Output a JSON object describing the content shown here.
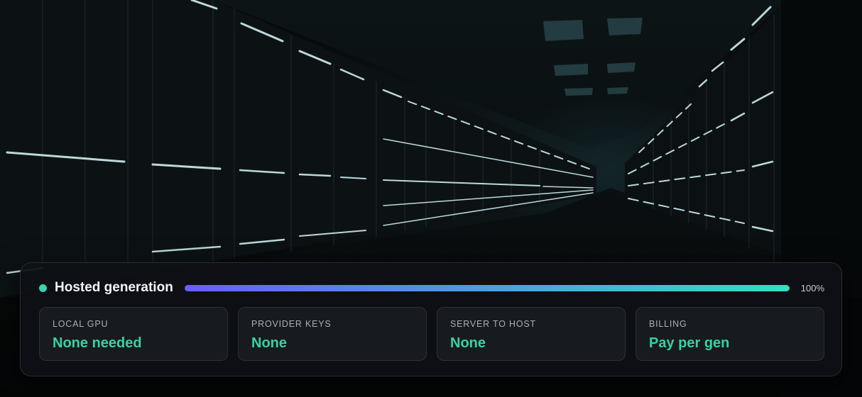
{
  "status": {
    "title": "Hosted generation",
    "progress_label": "100%",
    "progress": 1.0
  },
  "cards": [
    {
      "label": "LOCAL GPU",
      "value": "None needed"
    },
    {
      "label": "PROVIDER KEYS",
      "value": "None"
    },
    {
      "label": "SERVER TO HOST",
      "value": "None"
    },
    {
      "label": "BILLING",
      "value": "Pay per gen"
    }
  ],
  "colors": {
    "status_dot": "#35d6b0",
    "progress_start": "#6a5cff",
    "progress_end": "#2fe0c0",
    "value_text": "#36d3a0"
  },
  "background": {
    "description_icon": "server-room-image"
  }
}
